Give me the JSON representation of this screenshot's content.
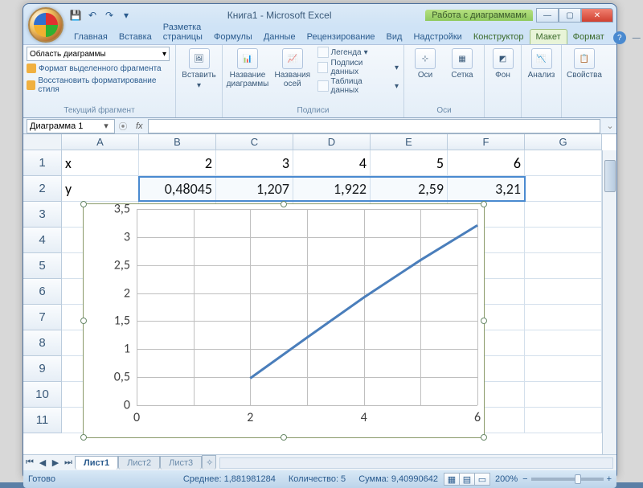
{
  "window": {
    "doc_title": "Книга1 - Microsoft Excel",
    "context_title": "Работа с диаграммами"
  },
  "qat": {
    "save": "💾",
    "undo": "↶",
    "redo": "↷"
  },
  "tabs": {
    "home": "Главная",
    "insert": "Вставка",
    "layout": "Разметка страницы",
    "formulas": "Формулы",
    "data": "Данные",
    "review": "Рецензирование",
    "view": "Вид",
    "addins": "Надстройки",
    "design": "Конструктор",
    "chart_layout": "Макет",
    "format": "Формат"
  },
  "ribbon": {
    "selection": {
      "combo_value": "Область диаграммы",
      "format_sel": "Формат выделенного фрагмента",
      "reset_style": "Восстановить форматирование стиля",
      "group": "Текущий фрагмент"
    },
    "insert": "Вставить",
    "labels": {
      "chart_title": "Название диаграммы",
      "axis_title": "Названия осей",
      "legend": "Легенда",
      "data_labels": "Подписи данных",
      "data_table": "Таблица данных",
      "group": "Подписи"
    },
    "axes": {
      "axes": "Оси",
      "grid": "Сетка",
      "group": "Оси"
    },
    "bg": {
      "bg": "Фон"
    },
    "analyze": "Анализ",
    "props": "Свойства"
  },
  "name_box": "Диаграмма 1",
  "fx_label": "fx",
  "columns": [
    "A",
    "B",
    "C",
    "D",
    "E",
    "F",
    "G"
  ],
  "rows": [
    "1",
    "2",
    "3",
    "4",
    "5",
    "6",
    "7",
    "8",
    "9",
    "10",
    "11"
  ],
  "cells": {
    "A1": "x",
    "B1": "2",
    "C1": "3",
    "D1": "4",
    "E1": "5",
    "F1": "6",
    "A2": "y",
    "B2": "0,48045",
    "C2": "1,207",
    "D2": "1,922",
    "E2": "2,59",
    "F2": "3,21"
  },
  "chart_data": {
    "type": "line",
    "x": [
      2,
      3,
      4,
      5,
      6
    ],
    "y": [
      0.48045,
      1.207,
      1.922,
      2.59,
      3.21
    ],
    "xlabel": "",
    "ylabel": "",
    "title": "",
    "xlim": [
      0,
      6
    ],
    "ylim": [
      0,
      3.5
    ],
    "xticks": [
      0,
      2,
      4,
      6
    ],
    "yticks": [
      0,
      0.5,
      1,
      1.5,
      2,
      2.5,
      3,
      3.5
    ],
    "ytick_labels": [
      "0",
      "0,5",
      "1",
      "1,5",
      "2",
      "2,5",
      "3",
      "3,5"
    ]
  },
  "sheets": {
    "s1": "Лист1",
    "s2": "Лист2",
    "s3": "Лист3"
  },
  "status": {
    "ready": "Готово",
    "avg": "Среднее: 1,881981284",
    "count": "Количество: 5",
    "sum": "Сумма: 9,40990642",
    "zoom": "200%"
  }
}
